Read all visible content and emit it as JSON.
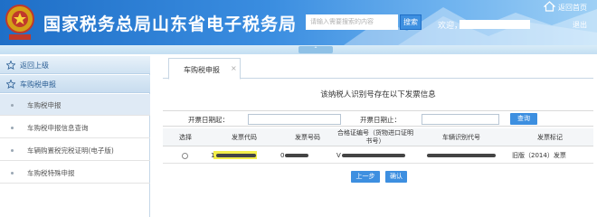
{
  "header": {
    "site_title": "国家税务总局山东省电子税务局",
    "search_placeholder": "请输入需要搜索的内容",
    "search_button": "搜索",
    "welcome_prefix": "欢迎，",
    "home_link": "返回首页",
    "logout_link": "退出",
    "collapse_glyph": "⌃"
  },
  "sidebar": {
    "back_label": "返回上级",
    "group_label": "车购税申报",
    "items": [
      {
        "label": "车购税申报"
      },
      {
        "label": "车购税申报信息查询"
      },
      {
        "label": "车辆购置税完税证明(电子版)"
      },
      {
        "label": "车购税特殊申报"
      }
    ]
  },
  "main": {
    "tab_label": "车购税申报",
    "tab_close": "×",
    "notice": "该纳税人识别号存在以下发票信息",
    "filter": {
      "start_label": "开票日期起：",
      "end_label": "开票日期止：",
      "query_button": "查询"
    },
    "table": {
      "columns": [
        "选择",
        "发票代码",
        "发票号码",
        "合格证编号（货物进口证明书号）",
        "车辆识别代号",
        "发票标记"
      ],
      "rows": [
        {
          "invoice_code": "1",
          "invoice_number": "0",
          "cert_no": "V",
          "vin": "",
          "mark": "旧版（2014）发票"
        }
      ]
    },
    "buttons": {
      "prev": "上一步",
      "confirm": "确认"
    }
  },
  "colors": {
    "brand_blue": "#1f6fc7",
    "button_blue": "#3d8fe0",
    "sidebar_text": "#2c5f95"
  },
  "icons": {
    "home": "home-icon",
    "star": "star-icon",
    "emblem": "tax-emblem-icon"
  }
}
